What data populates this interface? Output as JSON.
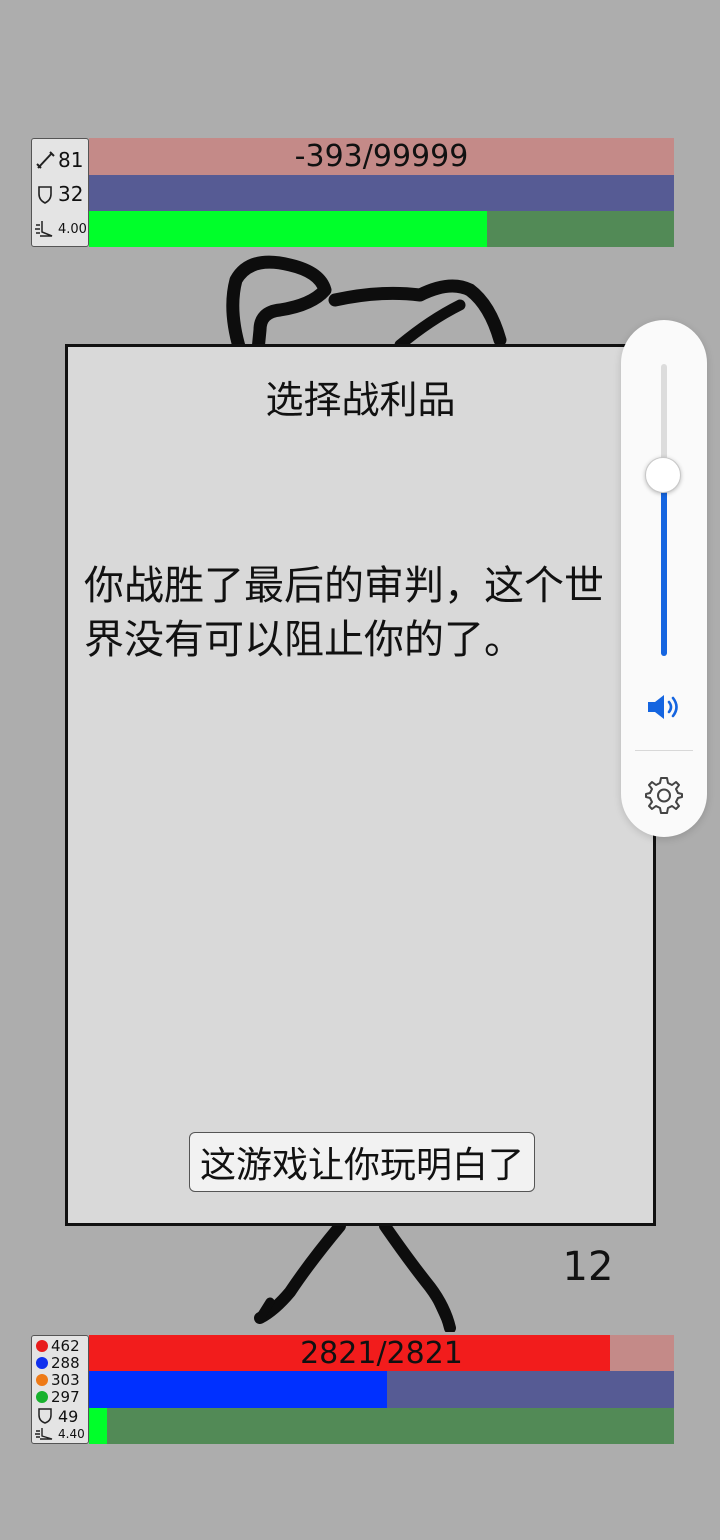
{
  "colors": {
    "background": "#adadad",
    "hp_empty": "#c48a88",
    "enemy_shield": "#565b94",
    "stamina_fill": "#00ff2a",
    "stamina_empty": "#528a56",
    "player_hp": "#f21c1c",
    "player_mana": "#0030ff",
    "volume_accent": "#1565e0"
  },
  "enemy": {
    "attack": "81",
    "defense": "32",
    "speed": "4.00",
    "hp_text": "-393/99999",
    "hp_fraction": 0,
    "shield_fraction": 1,
    "stamina_fraction": 0.68
  },
  "dialog": {
    "title": "选择战利品",
    "message": "你战胜了最后的审判，这个世界没有可以阻止你的了。",
    "button_label": "这游戏让你玩明白了"
  },
  "turn_counter": "12",
  "player": {
    "red": "462",
    "blue": "288",
    "orange": "303",
    "green": "297",
    "defense": "49",
    "speed": "4.40",
    "hp_text": "2821/2821",
    "hp_fraction": 0.89,
    "mana_fraction": 0.51,
    "stamina_fraction": 0.03
  },
  "volume": {
    "level": 0.62,
    "speaker_icon": "speaker-icon",
    "settings_icon": "gear-icon"
  }
}
